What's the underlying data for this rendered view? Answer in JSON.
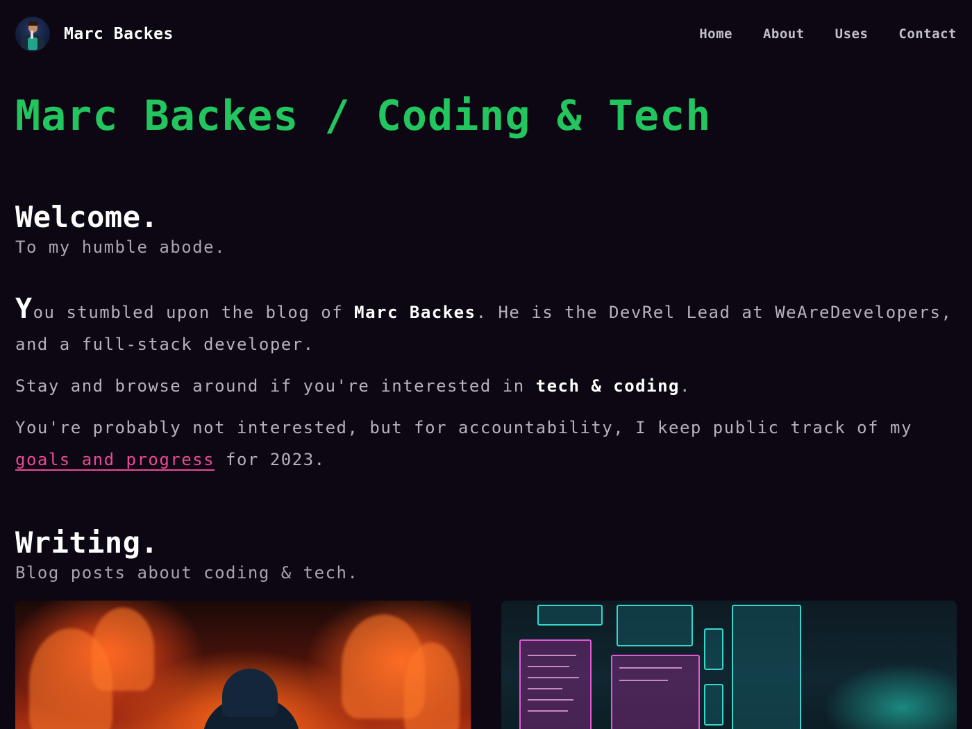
{
  "header": {
    "brand_name": "Marc Backes",
    "nav": [
      {
        "label": "Home"
      },
      {
        "label": "About"
      },
      {
        "label": "Uses"
      },
      {
        "label": "Contact"
      }
    ]
  },
  "hero": {
    "title": "Marc Backes / Coding & Tech"
  },
  "welcome": {
    "heading": "Welcome.",
    "subtitle": "To my humble abode."
  },
  "about": {
    "p1_dropcap": "Y",
    "p1_part1": "ou stumbled upon the blog of ",
    "p1_name": "Marc Backes",
    "p1_part2": ". He is the DevRel Lead at WeAreDevelopers, and a full-stack developer.",
    "p2_part1": "Stay and browse around if you're interested in ",
    "p2_strong": "tech & coding",
    "p2_part2": ".",
    "p3_part1": "You're probably not interested, but for accountability, I keep public track of my ",
    "p3_link": "goals and progress",
    "p3_part2": " for 2023."
  },
  "writing": {
    "heading": "Writing.",
    "subtitle": "Blog posts about coding & tech.",
    "cards": [
      {
        "image": "fire-person-image"
      },
      {
        "image": "neon-computer-room-image"
      }
    ]
  },
  "colors": {
    "background": "#0c0712",
    "accent_green": "#22c55e",
    "link_pink": "#ec4899",
    "text": "#b6b1bd"
  }
}
